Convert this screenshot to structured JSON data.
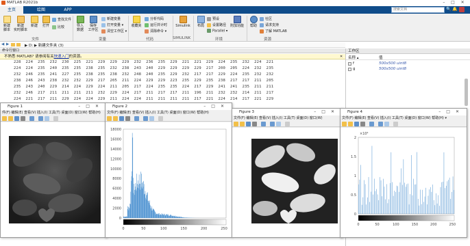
{
  "app": {
    "title": "MATLAB R2021b"
  },
  "tabs": [
    "主页",
    "绘图",
    "APP"
  ],
  "search_placeholder": "搜索文档",
  "ribbon": {
    "file": {
      "group": "文件",
      "new_script": "新建\n脚本",
      "new_live": "新建\n实时脚本",
      "new": "新建",
      "open": "打开",
      "find_files": "查找文件",
      "compare": "比较"
    },
    "variable": {
      "group": "变量",
      "import": "导入\n数据",
      "save_ws": "保存\n工作区",
      "new_var": "新建变量",
      "open_var": "打开变量 ▾",
      "clear_ws": "清空工作区 ▾"
    },
    "code": {
      "group": "代码",
      "favorites": "收藏夹",
      "analyze": "分析代码",
      "run_time": "运行并计时",
      "clear_cmd": "清除命令 ▾"
    },
    "simulink": {
      "group": "SIMULINK",
      "label": "Simulink"
    },
    "env": {
      "group": "环境",
      "layout": "布局",
      "prefs": "预设",
      "set_path": "设置路径",
      "parallel": "Parallel ▾",
      "addons": "附加功能"
    },
    "resources": {
      "group": "资源",
      "help": "帮助",
      "community": "社区",
      "support": "请求支持",
      "learn": "了解 MATLAB"
    }
  },
  "path": {
    "text": "▶ D: ▶ 新建文件夹 (3)"
  },
  "cmd_window": {
    "title": "命令行窗口"
  },
  "notice": {
    "pre": "不熟悉 MATLAB? 请参阅有关",
    "link": "快速入门",
    "post": "的资源。"
  },
  "number_rows": [
    "228  224  235  232  230  225  221  229  229  229  232  236  235  229  221  221  229  224  235  232  224  221",
    "224  224  235  240  235  235  238  235  232  238  243  240  229  229  229  229  217  200  205  224  232  235",
    "232  246  235  241  227  235  238  235  238  232  248  240  235  229  232  217  217  229  224  235  232  232",
    "238  246  243  238  232  232  229  217  205  211  224  229  229  223  235  229  235  238  217  217  211  205",
    "235  243  240  229  214  224  229  224  211  205  217  224  235  235  224  217  229  241  241  235  211  211",
    "232  246  217  211  211  211  211  232  229  224  217  211  217  217  211  196  211  232  232  214  211  217",
    "224  221  217  211  229  224  224  229  211  224  224  211  211  211  211  217  221  224  214  217  221  229"
  ],
  "workspace": {
    "title": "工作区",
    "col_name": "名称 ▴",
    "col_value": "值",
    "vars": [
      {
        "name": "f",
        "value": "500x500 uint8"
      },
      {
        "name": "g",
        "value": "500x500 uint8"
      }
    ]
  },
  "figures": [
    {
      "title": "Figure 1",
      "menu": "件(F)  编辑(E)  查看(V)  插入(I)  工具(T)  桌面(D)  窗口(W)  帮助(H)"
    },
    {
      "title": "Figure 2",
      "menu": "文件(F)  编辑(E)  查看(V)  插入(I)  工具(T)  桌面(D)  窗口(W)  帮助(H)"
    },
    {
      "title": "Figure 3",
      "menu": "文件(F)  编辑(E)  查看(V)  插入(I)  工具(T)  桌面(D)  窗口(W)"
    },
    {
      "title": "Figure 4",
      "menu": "文件(F)  编辑(E)  查看(V)  插入(I)  工具(T)  桌面(D)  窗口(W)  帮助(H) ▾"
    }
  ],
  "hist1": {
    "yticks": [
      "18000",
      "16000",
      "14000",
      "12000",
      "10000",
      "8000",
      "6000",
      "4000",
      "2000",
      "0"
    ],
    "xticks": [
      "0",
      "50",
      "100",
      "150",
      "200",
      "250"
    ]
  },
  "hist2": {
    "multiplier": "×10⁴",
    "yticks": [
      "2",
      "1.5",
      "1",
      "0.5",
      "0"
    ],
    "xticks": [
      "0",
      "50",
      "100",
      "150",
      "200",
      "250"
    ]
  },
  "colors": {
    "tabbar": "#0f4c8a",
    "hist": "#4a90d0"
  }
}
